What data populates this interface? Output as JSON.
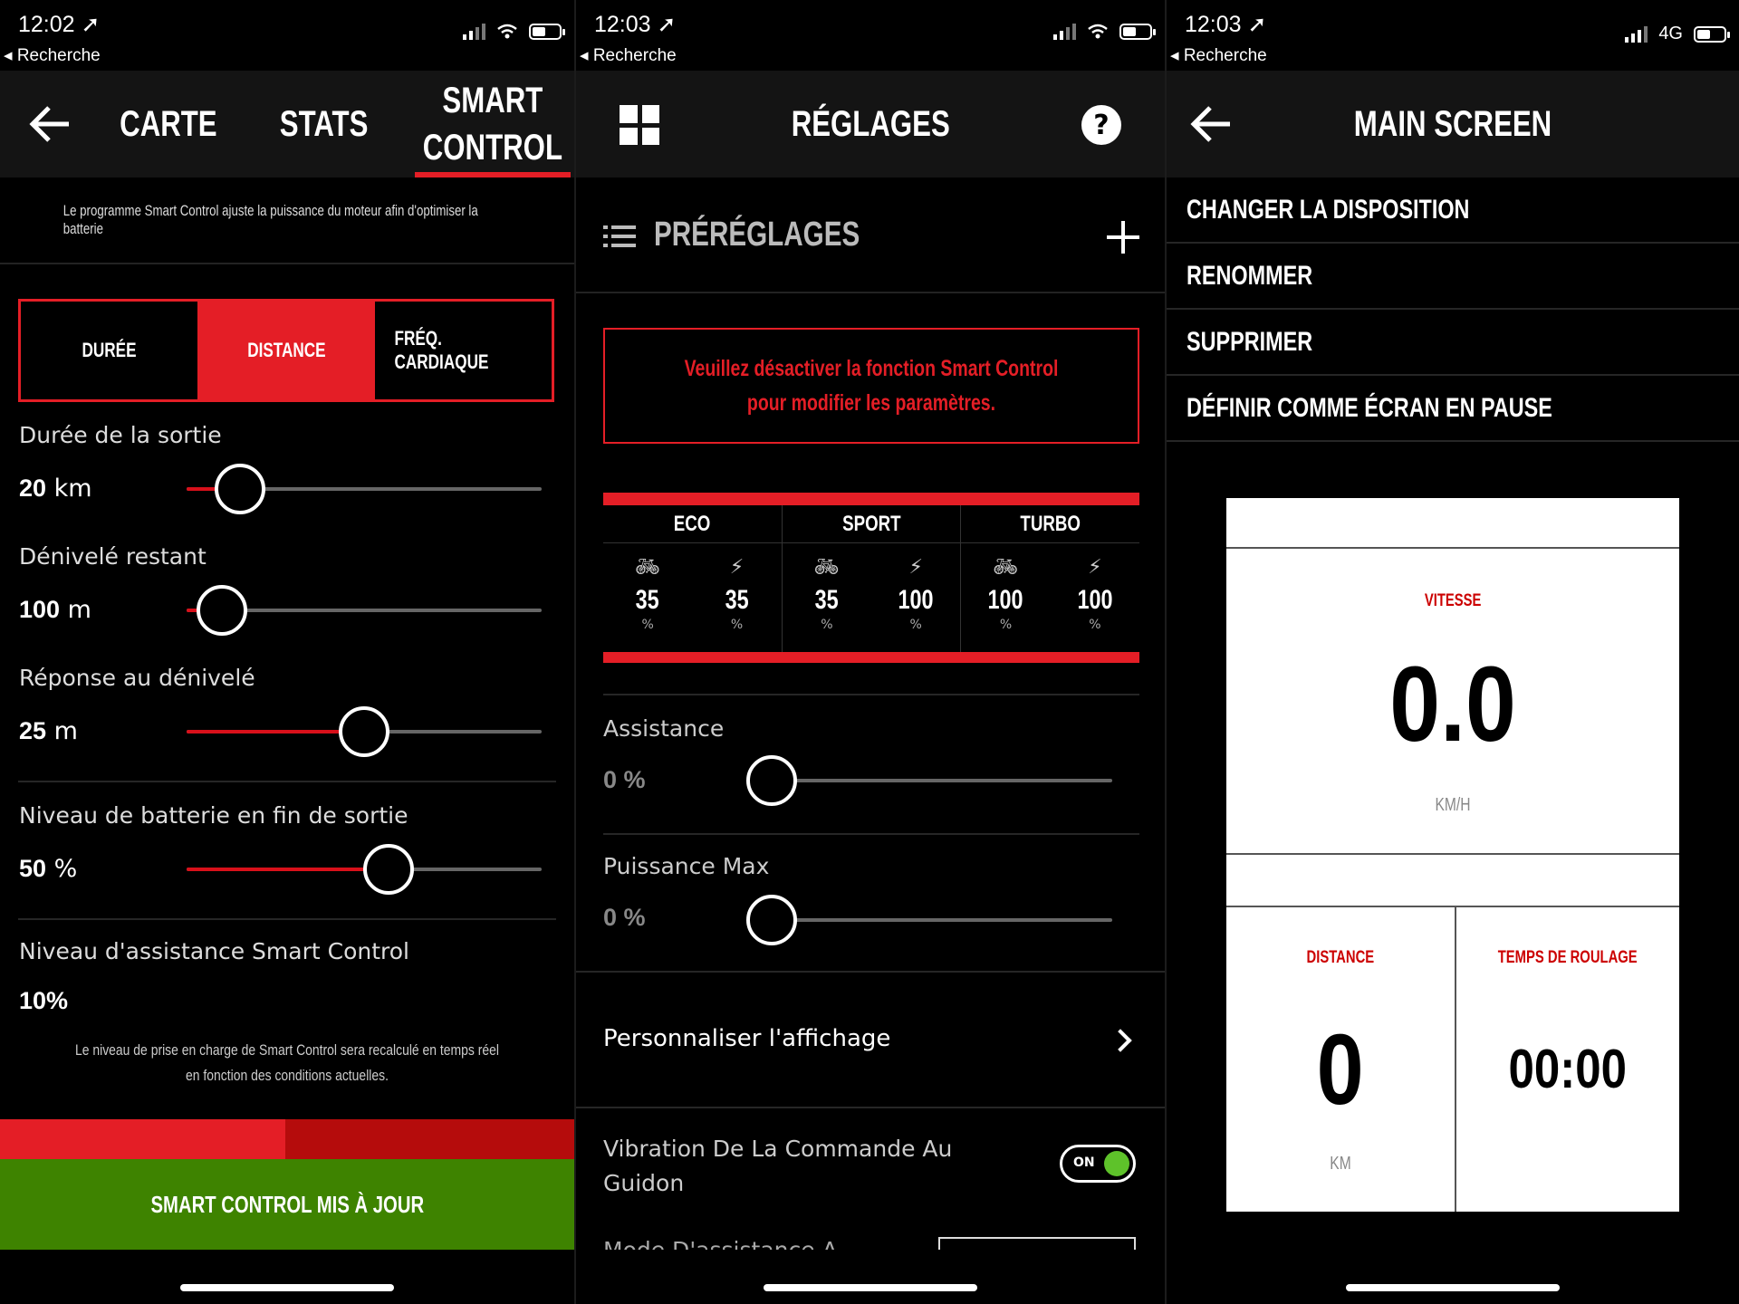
{
  "screen1": {
    "status": {
      "time": "12:02",
      "back_app": "Recherche"
    },
    "tabs": [
      "CARTE",
      "STATS",
      "SMART\nCONTROL"
    ],
    "tab_labels": {
      "carte": "CARTE",
      "stats": "STATS",
      "smart_1": "SMART",
      "smart_2": "CONTROL"
    },
    "description": "Le programme Smart Control ajuste la puissance du moteur afin d'optimiser la batterie",
    "segments": {
      "duree": "DURÉE",
      "distance": "DISTANCE",
      "freq": "FRÉQ. CARDIAQUE",
      "selected": "DISTANCE"
    },
    "sliders": [
      {
        "label": "Durée de la sortie",
        "value": "20",
        "unit": "km",
        "fraction": 0.15
      },
      {
        "label": "Dénivelé restant",
        "value": "100",
        "unit": "m",
        "fraction": 0.1
      },
      {
        "label": "Réponse au dénivelé",
        "value": "25",
        "unit": "m",
        "fraction": 0.5
      },
      {
        "label": "Niveau de batterie en fin de sortie",
        "value": "50",
        "unit": "%",
        "fraction": 0.57
      }
    ],
    "assist": {
      "label": "Niveau d'assistance Smart Control",
      "value": "10%"
    },
    "note": "Le niveau de prise en charge de Smart Control sera recalculé en temps réel en fonction des conditions actuelles.",
    "update_button": "SMART CONTROL MIS À JOUR",
    "colors": {
      "accent": "#e41e26",
      "dark_red": "#b50c0c",
      "green": "#3e8300"
    }
  },
  "screen2": {
    "status": {
      "time": "12:03",
      "back_app": "Recherche"
    },
    "title": "RÉGLAGES",
    "help": "?",
    "presets_label": "PRÉRÉGLAGES",
    "warning": "Veuillez désactiver la fonction Smart Control pour modifier les paramètres.",
    "modes": [
      {
        "name": "ECO",
        "assist": "35",
        "power": "35"
      },
      {
        "name": "SPORT",
        "assist": "35",
        "power": "100"
      },
      {
        "name": "TURBO",
        "assist": "100",
        "power": "100"
      }
    ],
    "percent": "%",
    "assistance": {
      "label": "Assistance",
      "value": "0 %",
      "fraction": 0
    },
    "max_power": {
      "label": "Puissance Max",
      "value": "0 %",
      "fraction": 0
    },
    "customize": "Personnaliser l'affichage",
    "vibration": {
      "label": "Vibration De La Commande Au Guidon",
      "toggle": "ON"
    },
    "cut_label": "Mode D'assistance A"
  },
  "screen3": {
    "status": {
      "time": "12:03",
      "back_app": "Recherche",
      "network": "4G"
    },
    "title": "MAIN SCREEN",
    "menu": [
      "CHANGER LA DISPOSITION",
      "RENOMMER",
      "SUPPRIMER",
      "DÉFINIR COMME ÉCRAN EN PAUSE"
    ],
    "preview": {
      "speed_label": "VITESSE",
      "speed_value": "0.0",
      "speed_unit": "KM/H",
      "distance_label": "DISTANCE",
      "distance_value": "0",
      "distance_unit": "KM",
      "time_label": "TEMPS DE ROULAGE",
      "time_value": "00:00"
    }
  }
}
